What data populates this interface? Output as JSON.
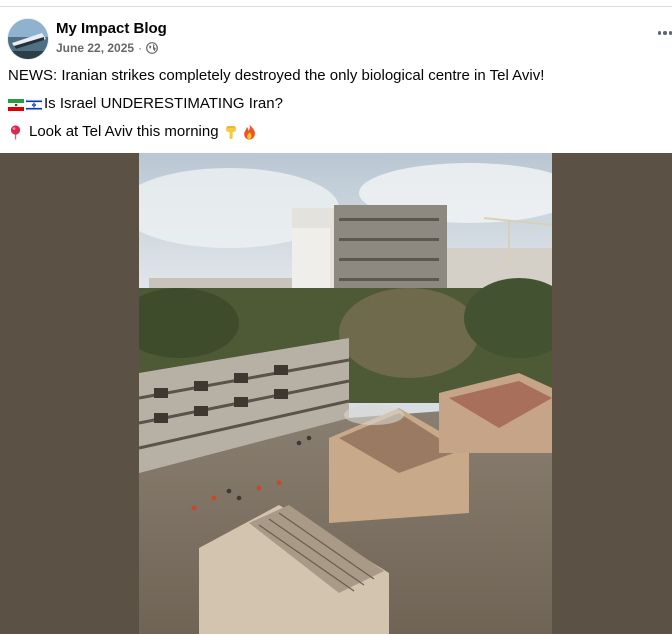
{
  "post": {
    "author": "My Impact Blog",
    "date": "June 22, 2025",
    "separator": "·",
    "lines": [
      "NEWS: Iranian strikes completely destroyed the only biological centre in Tel Aviv!",
      "Is Israel UNDERESTIMATING Iran?",
      "Look at Tel Aviv this morning"
    ]
  },
  "icons": {
    "avatar": "page-avatar",
    "privacy": "globe-icon",
    "more": "more-options-icon",
    "flags": [
      "iran-flag-icon",
      "israel-flag-icon"
    ],
    "pin": "round-pushpin-icon",
    "point_down": "point-down-icon",
    "fire": "fire-icon"
  },
  "media": {
    "letterbox_color": "#5b5144"
  }
}
